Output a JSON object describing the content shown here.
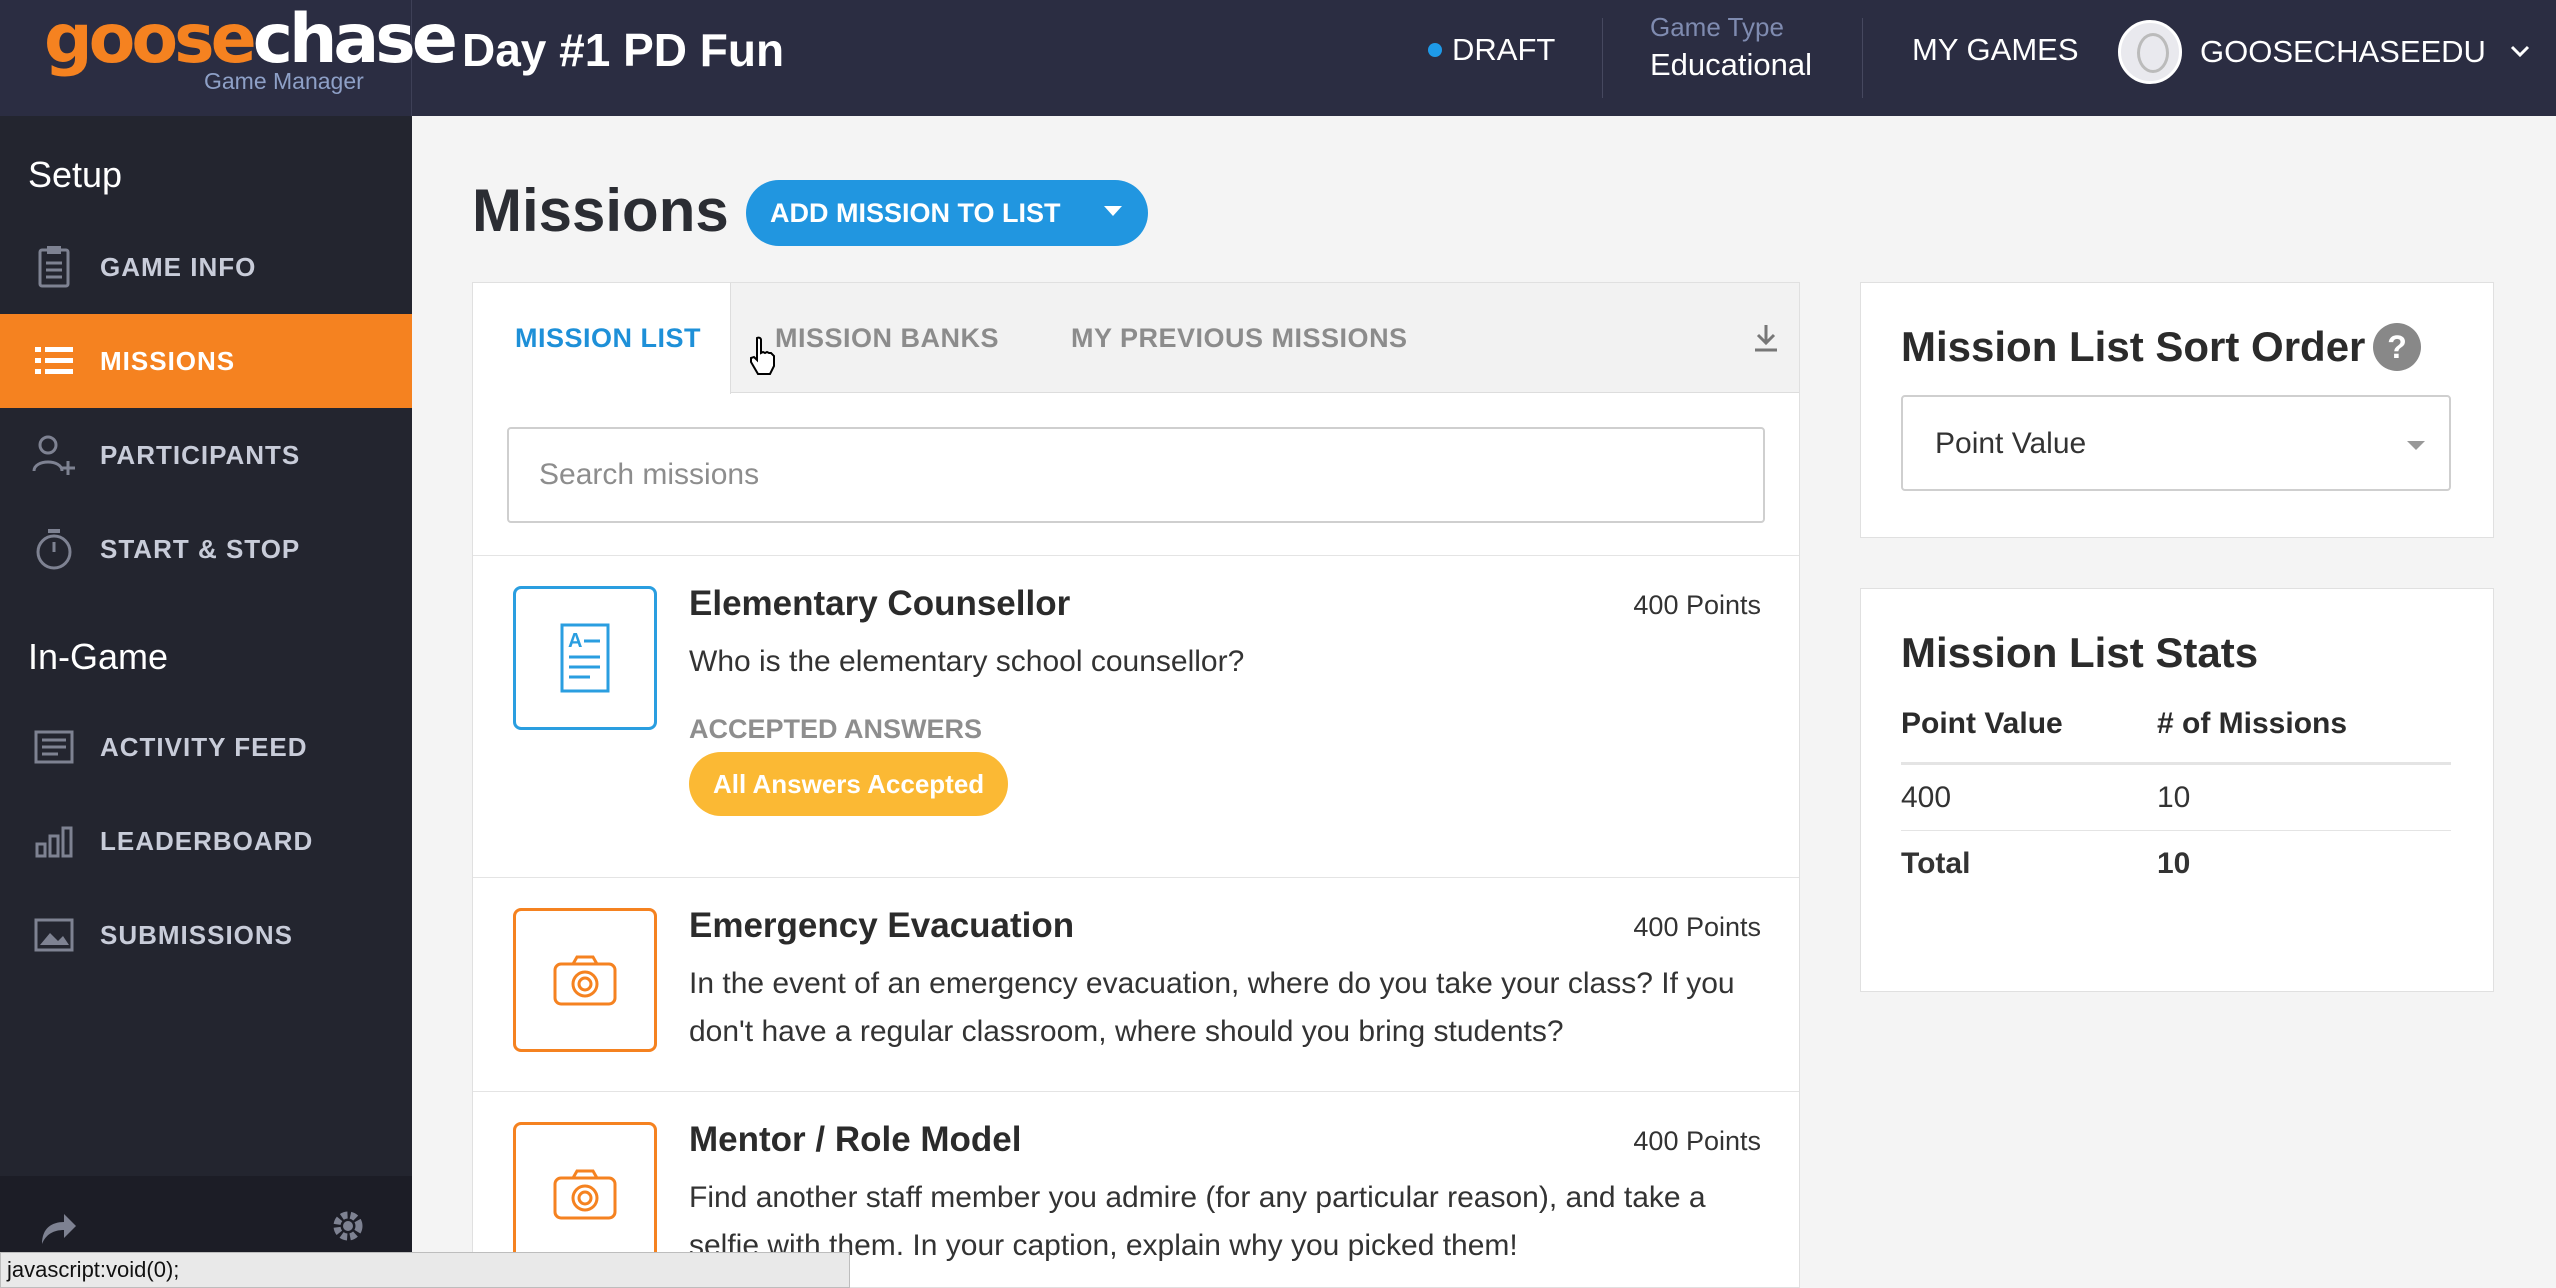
{
  "brand": {
    "name_part1": "goose",
    "name_part2": "chase",
    "subtitle": "Game Manager",
    "accent": "#f58220"
  },
  "header": {
    "game_title": "Day #1 PD Fun",
    "status": "DRAFT",
    "game_type_label": "Game Type",
    "game_type_value": "Educational",
    "my_games": "MY GAMES",
    "username": "GOOSECHASEEDU"
  },
  "sidebar": {
    "setup_heading": "Setup",
    "ingame_heading": "In-Game",
    "items": [
      {
        "label": "GAME INFO",
        "icon": "clipboard-icon"
      },
      {
        "label": "MISSIONS",
        "icon": "list-icon",
        "active": true
      },
      {
        "label": "PARTICIPANTS",
        "icon": "add-user-icon"
      },
      {
        "label": "START & STOP",
        "icon": "stopwatch-icon"
      },
      {
        "label": "ACTIVITY FEED",
        "icon": "feed-icon"
      },
      {
        "label": "LEADERBOARD",
        "icon": "bar-chart-icon"
      },
      {
        "label": "SUBMISSIONS",
        "icon": "image-icon"
      }
    ]
  },
  "main": {
    "title": "Missions",
    "add_button": "ADD MISSION TO LIST",
    "tabs": [
      "MISSION LIST",
      "MISSION BANKS",
      "MY PREVIOUS MISSIONS"
    ],
    "search_placeholder": "Search missions",
    "missions": [
      {
        "title": "Elementary Counsellor",
        "points": "400 Points",
        "description": "Who is the elementary school counsellor?",
        "accepted_label": "ACCEPTED ANSWERS",
        "badge": "All Answers Accepted",
        "type": "text",
        "color": "#2a9ee0"
      },
      {
        "title": "Emergency Evacuation",
        "points": "400 Points",
        "description": "In the event of an emergency evacuation, where do you take your class? If you don't have a regular classroom, where should you bring students?",
        "type": "photo",
        "color": "#f58220"
      },
      {
        "title": "Mentor / Role Model",
        "points": "400 Points",
        "description": "Find another staff member you admire (for any particular reason), and take a selfie with them. In your caption, explain why you picked them!",
        "type": "photo",
        "color": "#f58220"
      }
    ]
  },
  "sort_card": {
    "title": "Mission List Sort Order",
    "help": "?",
    "selected": "Point Value"
  },
  "stats_card": {
    "title": "Mission List Stats",
    "headers": [
      "Point Value",
      "# of Missions"
    ],
    "rows": [
      [
        "400",
        "10"
      ]
    ],
    "total": [
      "Total",
      "10"
    ]
  },
  "status_bar": "javascript:void(0);"
}
